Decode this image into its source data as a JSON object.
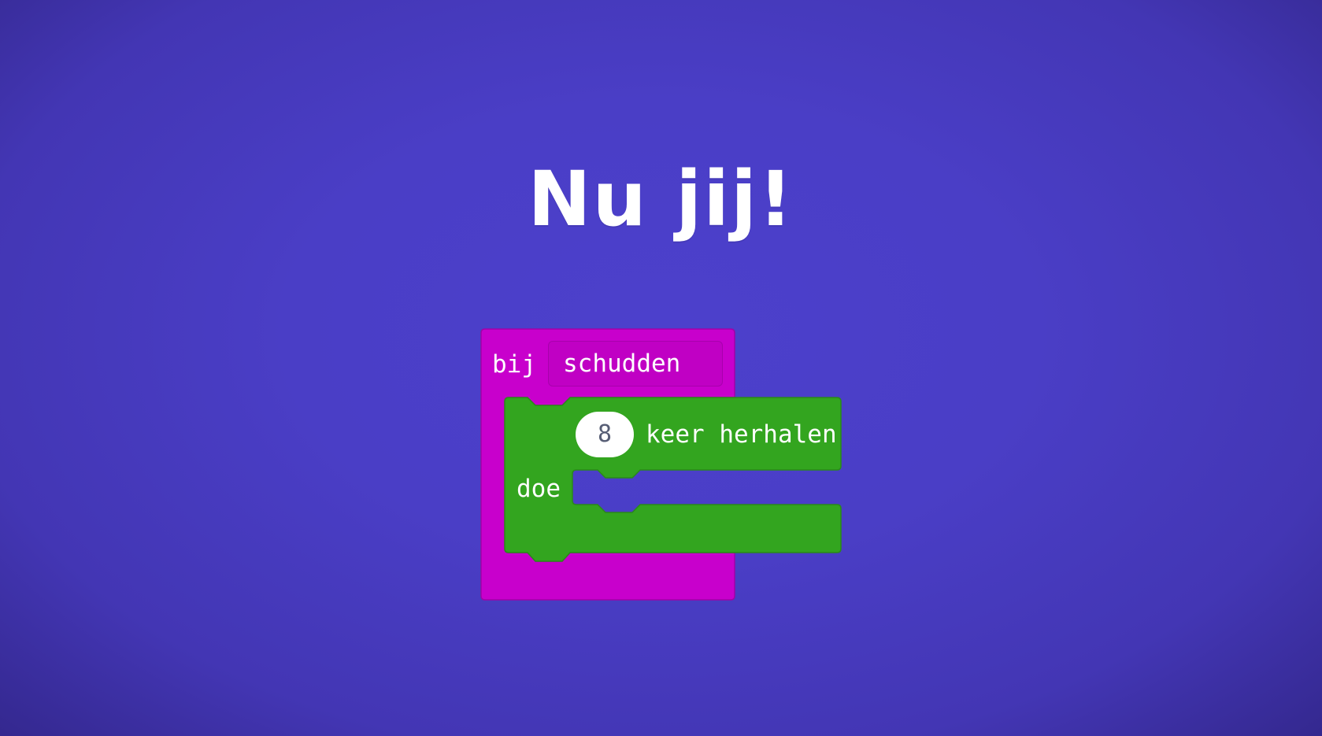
{
  "title": "Nu jij!",
  "colors": {
    "background": "#4a3ec6",
    "event_block": "#c800cc",
    "loop_block": "#33a51f",
    "text": "#ffffff"
  },
  "event_block": {
    "prefix": "bij",
    "dropdown_value": "schudden"
  },
  "loop_block": {
    "count": "8",
    "suffix": "keer herhalen",
    "do_label": "doe"
  }
}
